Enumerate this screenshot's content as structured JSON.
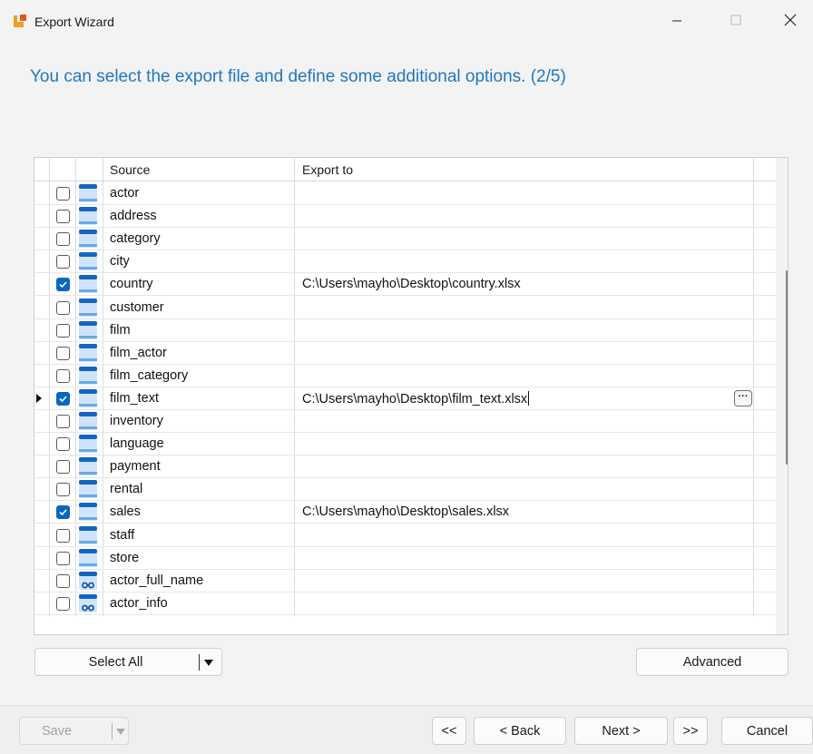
{
  "window": {
    "title": "Export Wizard",
    "minimize_glyph": "—",
    "maximize_glyph": "☐",
    "close_glyph": "✕"
  },
  "headline": "You can select the export file and define some additional options. (2/5)",
  "grid": {
    "columns": {
      "source": "Source",
      "export_to": "Export to"
    },
    "rows": [
      {
        "name": "actor",
        "checked": false,
        "export": "",
        "icon": "table-icon"
      },
      {
        "name": "address",
        "checked": false,
        "export": "",
        "icon": "table-icon"
      },
      {
        "name": "category",
        "checked": false,
        "export": "",
        "icon": "table-icon"
      },
      {
        "name": "city",
        "checked": false,
        "export": "",
        "icon": "table-icon"
      },
      {
        "name": "country",
        "checked": true,
        "export": "C:\\Users\\mayho\\Desktop\\country.xlsx",
        "icon": "table-icon"
      },
      {
        "name": "customer",
        "checked": false,
        "export": "",
        "icon": "table-icon"
      },
      {
        "name": "film",
        "checked": false,
        "export": "",
        "icon": "table-icon"
      },
      {
        "name": "film_actor",
        "checked": false,
        "export": "",
        "icon": "table-icon"
      },
      {
        "name": "film_category",
        "checked": false,
        "export": "",
        "icon": "table-icon"
      },
      {
        "name": "film_text",
        "checked": true,
        "export": "C:\\Users\\mayho\\Desktop\\film_text.xlsx",
        "icon": "table-icon",
        "current": true,
        "ellipsis": "···"
      },
      {
        "name": "inventory",
        "checked": false,
        "export": "",
        "icon": "table-icon"
      },
      {
        "name": "language",
        "checked": false,
        "export": "",
        "icon": "table-icon"
      },
      {
        "name": "payment",
        "checked": false,
        "export": "",
        "icon": "table-icon"
      },
      {
        "name": "rental",
        "checked": false,
        "export": "",
        "icon": "table-icon"
      },
      {
        "name": "sales",
        "checked": true,
        "export": "C:\\Users\\mayho\\Desktop\\sales.xlsx",
        "icon": "table-icon"
      },
      {
        "name": "staff",
        "checked": false,
        "export": "",
        "icon": "table-icon"
      },
      {
        "name": "store",
        "checked": false,
        "export": "",
        "icon": "table-icon"
      },
      {
        "name": "actor_full_name",
        "checked": false,
        "export": "",
        "icon": "view-icon"
      },
      {
        "name": "actor_info",
        "checked": false,
        "export": "",
        "icon": "view-icon"
      }
    ]
  },
  "buttons": {
    "select_all": "Select All",
    "advanced": "Advanced",
    "save": "Save",
    "first": "<<",
    "back": "< Back",
    "next": "Next >",
    "last": ">>",
    "cancel": "Cancel"
  },
  "colors": {
    "accent": "#1f77c2",
    "checkbox_checked": "#0a67c0",
    "table_icon_top": "#1565c0",
    "table_icon_body": "#cfe4fb"
  }
}
